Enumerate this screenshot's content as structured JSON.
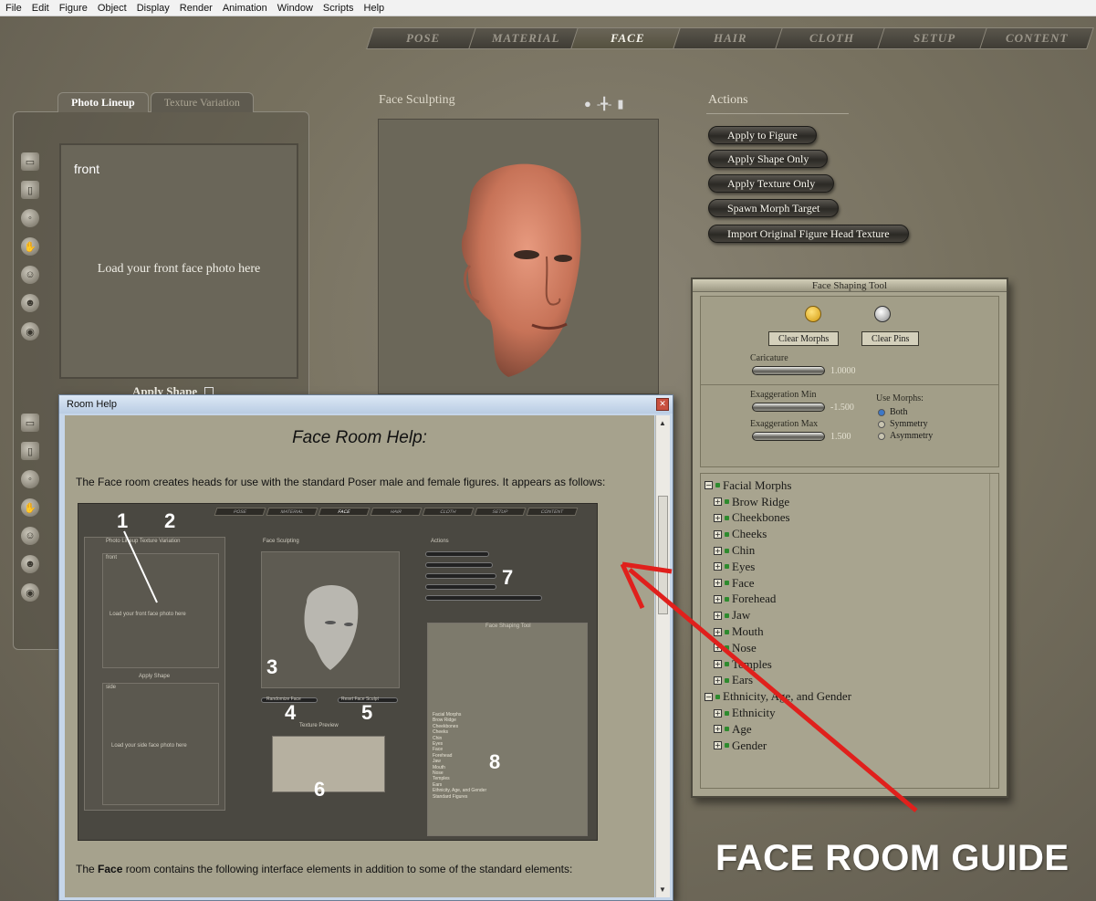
{
  "menubar": {
    "items": [
      "File",
      "Edit",
      "Figure",
      "Object",
      "Display",
      "Render",
      "Animation",
      "Window",
      "Scripts",
      "Help"
    ]
  },
  "room_tabs": [
    "POSE",
    "MATERIAL",
    "FACE",
    "HAIR",
    "CLOTH",
    "SETUP",
    "CONTENT"
  ],
  "active_tab": "FACE",
  "left_panel": {
    "tabs": [
      "Photo Lineup",
      "Texture Variation"
    ],
    "photo_label": "front",
    "photo_hint": "Load your front face photo here",
    "apply_shape": "Apply Shape"
  },
  "face_sculpting": {
    "title": "Face Sculpting"
  },
  "actions": {
    "title": "Actions",
    "buttons": [
      "Apply to Figure",
      "Apply Shape Only",
      "Apply Texture Only",
      "Spawn Morph Target",
      "Import Original Figure Head Texture"
    ]
  },
  "face_shaping_tool": {
    "title": "Face Shaping Tool",
    "clear_morphs": "Clear Morphs",
    "clear_pins": "Clear Pins",
    "caricature_label": "Caricature",
    "caricature_value": "1.0000",
    "exaggeration_min_label": "Exaggeration Min",
    "exaggeration_min_value": "-1.500",
    "exaggeration_max_label": "Exaggeration Max",
    "exaggeration_max_value": "1.500",
    "use_morphs_label": "Use Morphs:",
    "use_morphs_options": [
      "Both",
      "Symmetry",
      "Asymmetry"
    ],
    "use_morphs_selected": "Both",
    "tree": [
      {
        "label": "Facial Morphs",
        "level": 0,
        "state": "expanded"
      },
      {
        "label": "Brow Ridge",
        "level": 1,
        "state": "collapsed"
      },
      {
        "label": "Cheekbones",
        "level": 1,
        "state": "collapsed"
      },
      {
        "label": "Cheeks",
        "level": 1,
        "state": "collapsed"
      },
      {
        "label": "Chin",
        "level": 1,
        "state": "collapsed"
      },
      {
        "label": "Eyes",
        "level": 1,
        "state": "collapsed"
      },
      {
        "label": "Face",
        "level": 1,
        "state": "collapsed"
      },
      {
        "label": "Forehead",
        "level": 1,
        "state": "collapsed"
      },
      {
        "label": "Jaw",
        "level": 1,
        "state": "collapsed"
      },
      {
        "label": "Mouth",
        "level": 1,
        "state": "collapsed"
      },
      {
        "label": "Nose",
        "level": 1,
        "state": "collapsed"
      },
      {
        "label": "Temples",
        "level": 1,
        "state": "collapsed"
      },
      {
        "label": "Ears",
        "level": 1,
        "state": "collapsed"
      },
      {
        "label": "Ethnicity, Age, and Gender",
        "level": 0,
        "state": "expanded"
      },
      {
        "label": "Ethnicity",
        "level": 1,
        "state": "collapsed"
      },
      {
        "label": "Age",
        "level": 1,
        "state": "collapsed"
      },
      {
        "label": "Gender",
        "level": 1,
        "state": "collapsed"
      }
    ]
  },
  "room_help": {
    "window_title": "Room Help",
    "heading": "Face Room Help:",
    "intro": "The Face room creates heads for use with the standard Poser male and female figures. It appears as follows:",
    "footer_prefix": "The ",
    "footer_bold": "Face",
    "footer_suffix": " room contains the following interface elements in addition to some of the standard elements:",
    "guide_numbers": [
      "1",
      "2",
      "3",
      "4",
      "5",
      "6",
      "7",
      "8"
    ],
    "guide_texts": {
      "tabs": [
        "POSE",
        "MATERIAL",
        "FACE",
        "HAIR",
        "CLOTH",
        "SETUP",
        "CONTENT"
      ],
      "photo_tabs": "Photo Lineup   Texture Variation",
      "front": "front",
      "front_hint": "Load your front face photo here",
      "apply_shape": "Apply Shape",
      "side": "side",
      "side_hint": "Load your side face photo here",
      "sculpting": "Face Sculpting",
      "actions": "Actions",
      "random_face": "Randomize Face",
      "reset_face": "Reset Face Sculpt",
      "texture_preview": "Texture Preview",
      "fst_title": "Face Shaping Tool",
      "tree": [
        "Facial Morphs",
        "Brow Ridge",
        "Cheekbones",
        "Cheeks",
        "Chin",
        "Eyes",
        "Face",
        "Forehead",
        "Jaw",
        "Mouth",
        "Nose",
        "Temples",
        "Ears",
        "Ethnicity, Age, and Gender",
        "Standard Figures"
      ]
    }
  },
  "guide_label": "FACE ROOM GUIDE",
  "colors": {
    "app_bg": "#77715f",
    "panel_bg": "#a8a48f",
    "help_frame": "#c6d6e9",
    "arrow": "#e0201c",
    "pin_gold": "#e8b21a",
    "radio_on": "#3d78c8"
  }
}
